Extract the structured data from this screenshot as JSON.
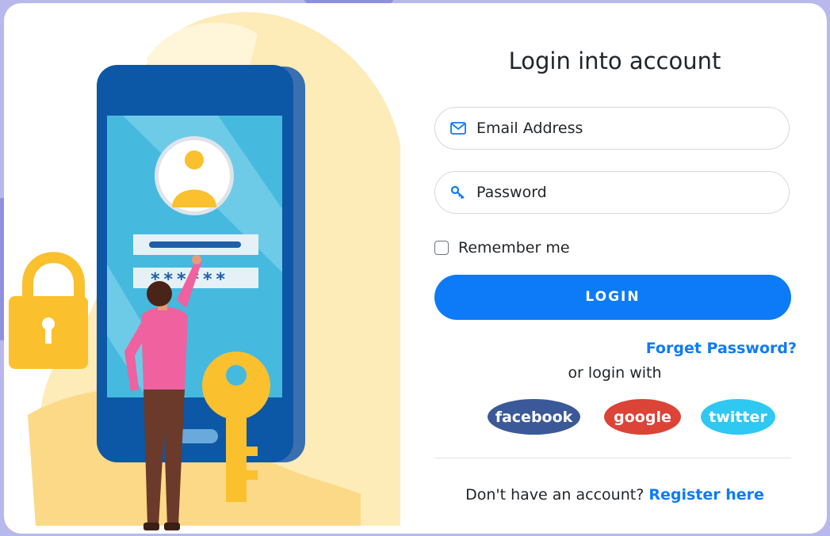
{
  "colors": {
    "page_background": "#b7b8ec",
    "accent": "#0d7bf8",
    "facebook": "#3b5998",
    "google": "#db4437",
    "twitter": "#2ec8f2"
  },
  "login": {
    "title": "Login into account",
    "email": {
      "placeholder": "Email Address",
      "value": "",
      "icon": "envelope-icon"
    },
    "password": {
      "placeholder": "Password",
      "value": "",
      "icon": "key-icon"
    },
    "remember_label": "Remember me",
    "remember_checked": false,
    "login_button": "LOGIN",
    "forgot_link": "Forget Password?",
    "or_login_with": "or login with",
    "social": [
      {
        "id": "facebook",
        "label": "facebook"
      },
      {
        "id": "google",
        "label": "google"
      },
      {
        "id": "twitter",
        "label": "twitter"
      }
    ],
    "register_prompt": "Don't have an account?",
    "register_link": "Register here"
  },
  "illustration": {
    "password_mask": "******"
  }
}
